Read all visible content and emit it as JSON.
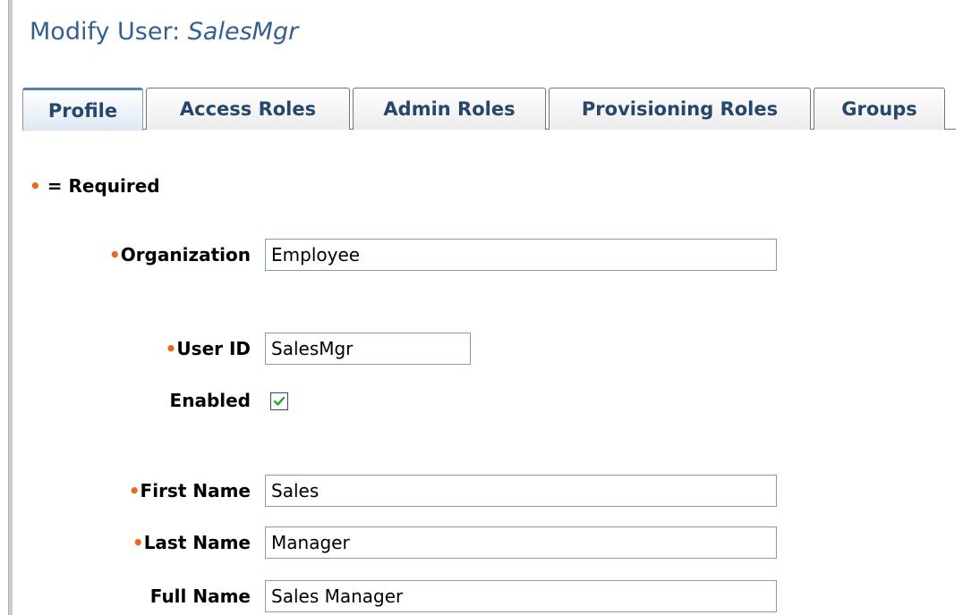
{
  "header": {
    "title_prefix": "Modify User: ",
    "title_user": "SalesMgr"
  },
  "tabs": [
    {
      "label": "Profile",
      "active": true
    },
    {
      "label": "Access Roles",
      "active": false
    },
    {
      "label": "Admin Roles",
      "active": false
    },
    {
      "label": "Provisioning Roles",
      "active": false
    },
    {
      "label": "Groups",
      "active": false
    }
  ],
  "required_note": {
    "marker": "•",
    "text": " = Required"
  },
  "form": {
    "organization": {
      "marker": "•",
      "label": "Organization",
      "value": "Employee",
      "required": true
    },
    "user_id": {
      "marker": "•",
      "label": "User ID",
      "value": "SalesMgr",
      "required": true
    },
    "enabled": {
      "label": "Enabled",
      "checked": true
    },
    "first_name": {
      "marker": "•",
      "label": "First Name",
      "value": "Sales",
      "required": true
    },
    "last_name": {
      "marker": "•",
      "label": "Last Name",
      "value": "Manager",
      "required": true
    },
    "full_name": {
      "label": "Full Name",
      "value": "Sales Manager",
      "required": false
    }
  },
  "colors": {
    "title": "#365f91",
    "tab_text": "#27466b",
    "required_marker": "#e8691c",
    "field_border": "#7f9db9"
  }
}
